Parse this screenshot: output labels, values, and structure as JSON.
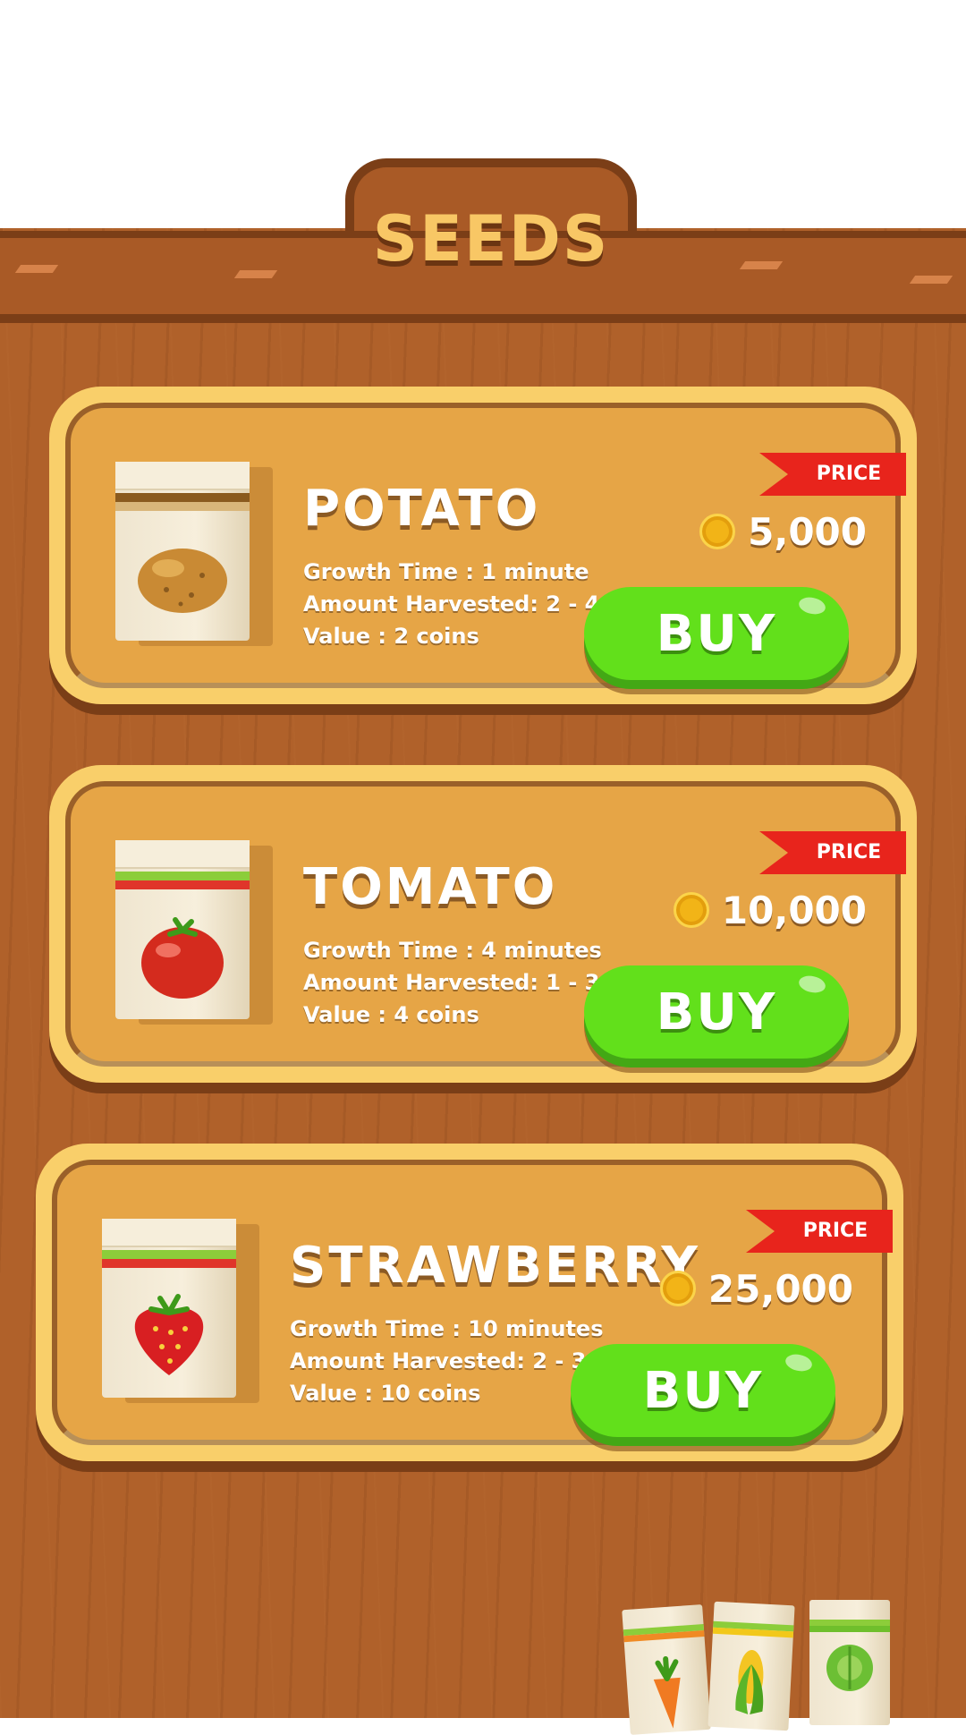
{
  "header": {
    "title": "SEEDS"
  },
  "shop": {
    "items": [
      {
        "name": "POTATO",
        "growth": "Growth Time : 1 minute",
        "amount": "Amount Harvested: 2 - 4",
        "value": "Value : 2 coins",
        "price_label": "PRICE",
        "price": "5,000",
        "buy_label": "BUY",
        "icon": "potato-icon"
      },
      {
        "name": "TOMATO",
        "growth": "Growth Time : 4 minutes",
        "amount": "Amount Harvested: 1 - 3",
        "value": "Value : 4 coins",
        "price_label": "PRICE",
        "price": "10,000",
        "buy_label": "BUY",
        "icon": "tomato-icon"
      },
      {
        "name": "STRAWBERRY",
        "growth": "Growth Time : 10 minutes",
        "amount": "Amount Harvested: 2 - 3",
        "value": "Value : 10 coins",
        "price_label": "PRICE",
        "price": "25,000",
        "buy_label": "BUY",
        "icon": "strawberry-icon"
      }
    ]
  },
  "decor": {
    "packets": [
      "carrot-icon",
      "corn-icon",
      "cabbage-icon"
    ]
  },
  "colors": {
    "board": "#b0612a",
    "card": "#e6a546",
    "buy": "#62e01b",
    "ribbon": "#e8241c",
    "title": "#f8c765"
  }
}
